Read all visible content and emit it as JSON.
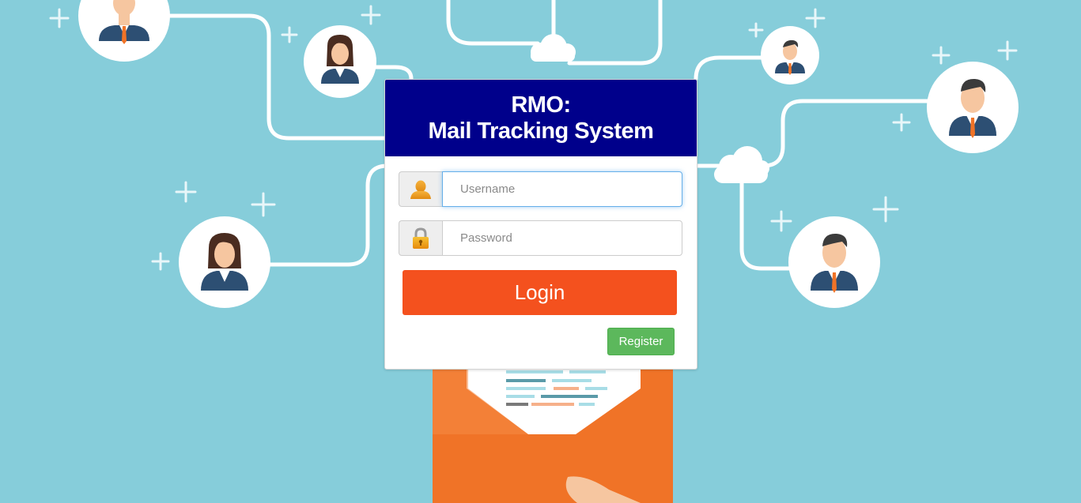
{
  "header": {
    "title_line1": "RMO:",
    "title_line2": "Mail Tracking System"
  },
  "form": {
    "username_placeholder": "Username",
    "username_value": "",
    "password_placeholder": "Password",
    "password_value": "",
    "user_icon": "user-icon",
    "lock_icon": "lock-icon",
    "login_label": "Login",
    "register_label": "Register"
  },
  "colors": {
    "background": "#86cdda",
    "header": "#00008b",
    "login_button": "#f4511e",
    "register_button": "#5cb85c",
    "envelope": "#f07327"
  }
}
